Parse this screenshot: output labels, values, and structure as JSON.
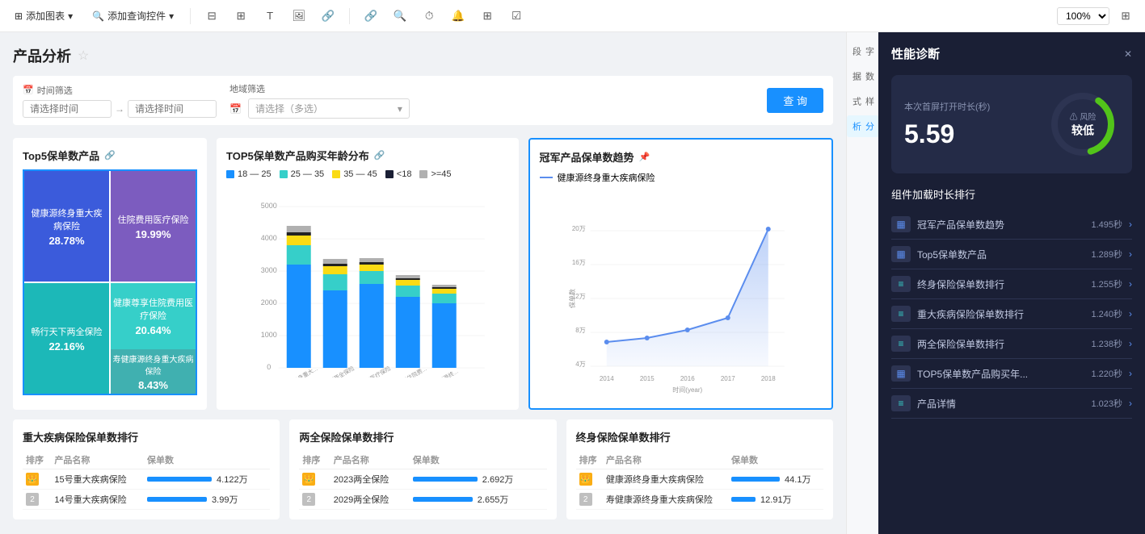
{
  "toolbar": {
    "add_chart_label": "添加图表",
    "add_query_label": "添加查询控件",
    "zoom": "100%",
    "icons": [
      "table-icon",
      "card-icon",
      "text-icon",
      "image-icon",
      "link-icon",
      "share-icon",
      "search-icon",
      "clock-icon",
      "alert-icon",
      "grid-icon",
      "check-icon",
      "fit-icon"
    ]
  },
  "page": {
    "title": "产品分析",
    "star": "☆"
  },
  "filters": {
    "time_label": "时间筛选",
    "time_from_placeholder": "请选择时间",
    "time_to_placeholder": "请选择时间",
    "region_label": "地域筛选",
    "region_placeholder": "请选择（多选）",
    "query_btn": "查 询"
  },
  "top5_product": {
    "title": "Top5保单数产品",
    "cells": [
      {
        "name": "健康源终身重大疾病保险",
        "pct": "28.78%",
        "color": "#3b5bdb"
      },
      {
        "name": "住院费用医疗保险",
        "pct": "19.99%",
        "color": "#7c5cbf"
      },
      {
        "name": "畅行天下两全保险",
        "pct": "22.16%",
        "color": "#1cb8b8"
      },
      {
        "name": "健康尊享住院费用医疗保险",
        "pct": "20.64%",
        "color": "#36cfc9"
      },
      {
        "name": "寿健康源终身重大疾病保险",
        "pct": "8.43%",
        "color": "#40b0b0"
      }
    ]
  },
  "top5_bar": {
    "title": "TOP5保单数产品购买年龄分布",
    "legend": [
      {
        "label": "18 — 25",
        "color": "#1890ff"
      },
      {
        "label": "25 — 35",
        "color": "#36cfc9"
      },
      {
        "label": "35 — 45",
        "color": "#fadb14"
      },
      {
        "label": "<18",
        "color": "#1a1f35"
      },
      {
        "label": ">=45",
        "color": "#b0b0b0"
      }
    ],
    "y_max": 5000,
    "y_ticks": [
      0,
      1000,
      2000,
      3000,
      4000,
      5000
    ],
    "bars": [
      {
        "label": "健康源终身重大...",
        "segments": [
          3200,
          600,
          300,
          100,
          200
        ]
      },
      {
        "label": "畅行天下两全保险",
        "segments": [
          2400,
          500,
          250,
          80,
          150
        ]
      },
      {
        "label": "住院费用医疗保险",
        "segments": [
          2600,
          400,
          200,
          60,
          120
        ]
      },
      {
        "label": "健康尊享住院费...",
        "segments": [
          2200,
          350,
          180,
          50,
          100
        ]
      },
      {
        "label": "寿健康源终...",
        "segments": [
          2000,
          300,
          150,
          40,
          80
        ]
      }
    ]
  },
  "champion_line": {
    "title": "冠军产品保单数趋势",
    "series_label": "健康源终身重大疾病保险",
    "x_labels": [
      "2014",
      "2015",
      "2016",
      "2017",
      "2018"
    ],
    "y_labels": [
      "4万",
      "8万",
      "12万",
      "16万",
      "20万"
    ],
    "x_axis_label": "时间(year)",
    "y_axis_label": "保\n单\n数"
  },
  "critical_illness_table": {
    "title": "重大疾病保险保单数排行",
    "col_rank": "排序",
    "col_name": "产品名称",
    "col_count": "保单数",
    "rows": [
      {
        "rank": 1,
        "rank_type": "gold",
        "name": "15号重大疾病保险",
        "count": "4.122万",
        "bar": 95
      },
      {
        "rank": 2,
        "rank_type": "silver",
        "name": "14号重大疾病保险",
        "count": "3.99万",
        "bar": 90
      }
    ]
  },
  "two_complete_table": {
    "title": "两全保险保单数排行",
    "col_rank": "排序",
    "col_name": "产品名称",
    "col_count": "保单数",
    "rows": [
      {
        "rank": 1,
        "rank_type": "gold",
        "name": "2023两全保险",
        "count": "2.692万",
        "bar": 95
      },
      {
        "rank": 2,
        "rank_type": "silver",
        "name": "2029两全保险",
        "count": "2.655万",
        "bar": 88
      }
    ]
  },
  "life_table": {
    "title": "终身保险保单数排行",
    "col_rank": "排序",
    "col_name": "产品名称",
    "col_count": "保单数",
    "rows": [
      {
        "rank": 1,
        "rank_type": "gold",
        "name": "健康源终身重大疾病保险",
        "count": "44.1万",
        "bar": 95
      },
      {
        "rank": 2,
        "rank_type": "silver",
        "name": "寿健康源终身重大疾病保险",
        "count": "12.91万",
        "bar": 55
      }
    ]
  },
  "perf": {
    "title": "性能诊断",
    "first_screen_label": "本次首屏打开时长(秒)",
    "first_screen_value": "5.59",
    "risk_label": "风险",
    "risk_level": "较低",
    "component_section_title": "组件加载时长排行",
    "components": [
      {
        "name": "冠军产品保单数趋势",
        "time": "1.495秒",
        "icon_type": "bar"
      },
      {
        "name": "Top5保单数产品",
        "time": "1.289秒",
        "icon_type": "bar"
      },
      {
        "name": "终身保险保单数排行",
        "time": "1.255秒",
        "icon_type": "list"
      },
      {
        "name": "重大疾病保险保单数排行",
        "time": "1.240秒",
        "icon_type": "list"
      },
      {
        "name": "两全保险保单数排行",
        "time": "1.238秒",
        "icon_type": "list"
      },
      {
        "name": "TOP5保单数产品购买年...",
        "time": "1.220秒",
        "icon_type": "bar"
      },
      {
        "name": "产品详情",
        "time": "1.023秒",
        "icon_type": "list"
      }
    ]
  },
  "side_tabs": [
    "字段",
    "数据",
    "样式",
    "分析"
  ],
  "active_side_tab": "分析"
}
